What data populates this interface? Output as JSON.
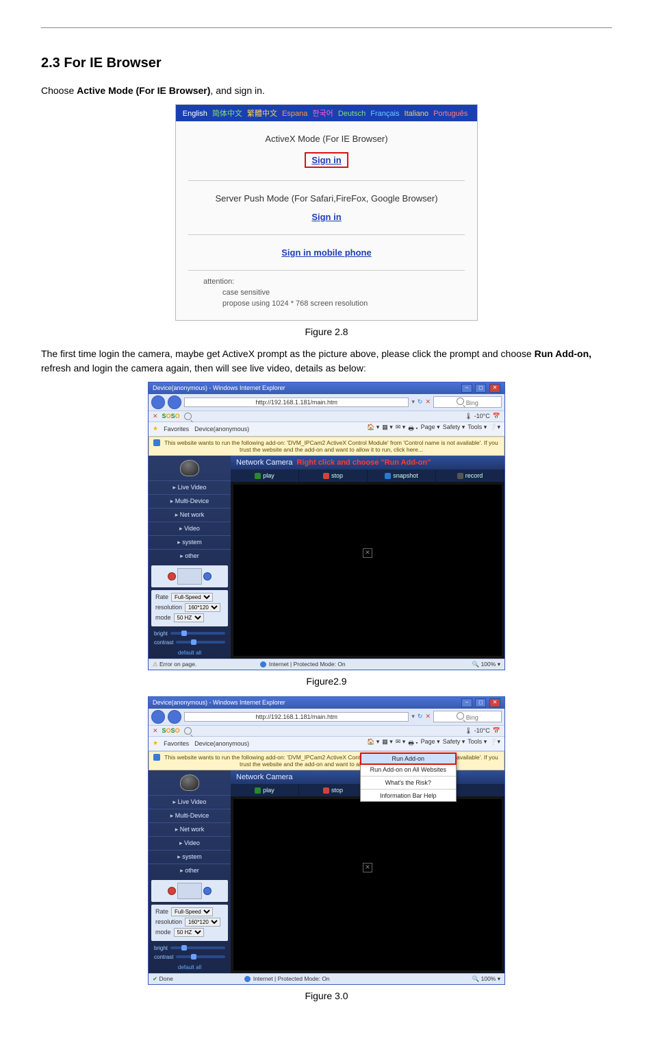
{
  "heading": "2.3 For IE Browser",
  "intro_prefix": "Choose ",
  "intro_bold": "Active Mode (For IE Browser)",
  "intro_suffix": ", and sign in.",
  "fig28": {
    "lang": {
      "en": "English",
      "sc": "简体中文",
      "tc": "繁體中文",
      "es": "Espana",
      "kr": "한국어",
      "de": "Deutsch",
      "fr": "Français",
      "it": "Italiano",
      "pt": "Português"
    },
    "mode_activex": "ActiveX Mode (For IE Browser)",
    "signin": "Sign in",
    "mode_push": "Server Push Mode (For Safari,FireFox, Google Browser)",
    "mobile": "Sign in mobile phone",
    "att_label": "attention:",
    "att_line1": "case sensitive",
    "att_line2": "propose using 1024 * 768 screen resolution",
    "caption": "Figure 2.8"
  },
  "para2_a": "The first time login the camera, maybe get ActiveX prompt as the picture above, please click the prompt and choose ",
  "para2_b": "Run Add-on,",
  "para2_c": " refresh and login the camera again, then will see live video, details as below",
  "para2_colon": ":",
  "ie_common": {
    "title": "Device(anonymous) - Windows Internet Explorer",
    "url": "http://192.168.1.181/main.htm",
    "search_placeholder": "Bing",
    "soso": "SOSO",
    "fav_label": "Favorites",
    "tab": "Device(anonymous)",
    "right_menu": {
      "page": "Page ▾",
      "safety": "Safety ▾",
      "tools": "Tools ▾"
    },
    "infobar": "This website wants to run the following add-on: 'DVM_IPCam2 ActiveX Control Module' from 'Control name is not available'. If you trust the website and the add-on and want to allow it to run, click here...",
    "net_title": "Network Camera",
    "menu": {
      "live": "Live Video",
      "multi": "Multi-Device",
      "net": "Net work",
      "video": "Video",
      "system": "system",
      "other": "other"
    },
    "btns": {
      "play": "play",
      "stop": "stop",
      "snap": "snapshot",
      "rec": "record"
    },
    "ctrl": {
      "rate_l": "Rate",
      "rate_v": "Full-Speed",
      "res_l": "resolution",
      "res_v": "160*120",
      "mode_l": "mode",
      "mode_v": "50 HZ"
    },
    "sliders": {
      "bright": "bright",
      "contrast": "contrast"
    },
    "default_all": "default all",
    "status_mode": "Internet | Protected Mode: On",
    "zoom": "100%"
  },
  "fig29": {
    "annotation": "Right click and choose \"Run Add-on\"",
    "status_left": "Error on page.",
    "caption": "Figure2.9"
  },
  "fig30": {
    "ctx": {
      "run": "Run Add-on",
      "run_all": "Run Add-on on All Websites",
      "risk": "What's the Risk?",
      "help": "Information Bar Help"
    },
    "status_left": "Done",
    "caption": "Figure 3.0"
  }
}
